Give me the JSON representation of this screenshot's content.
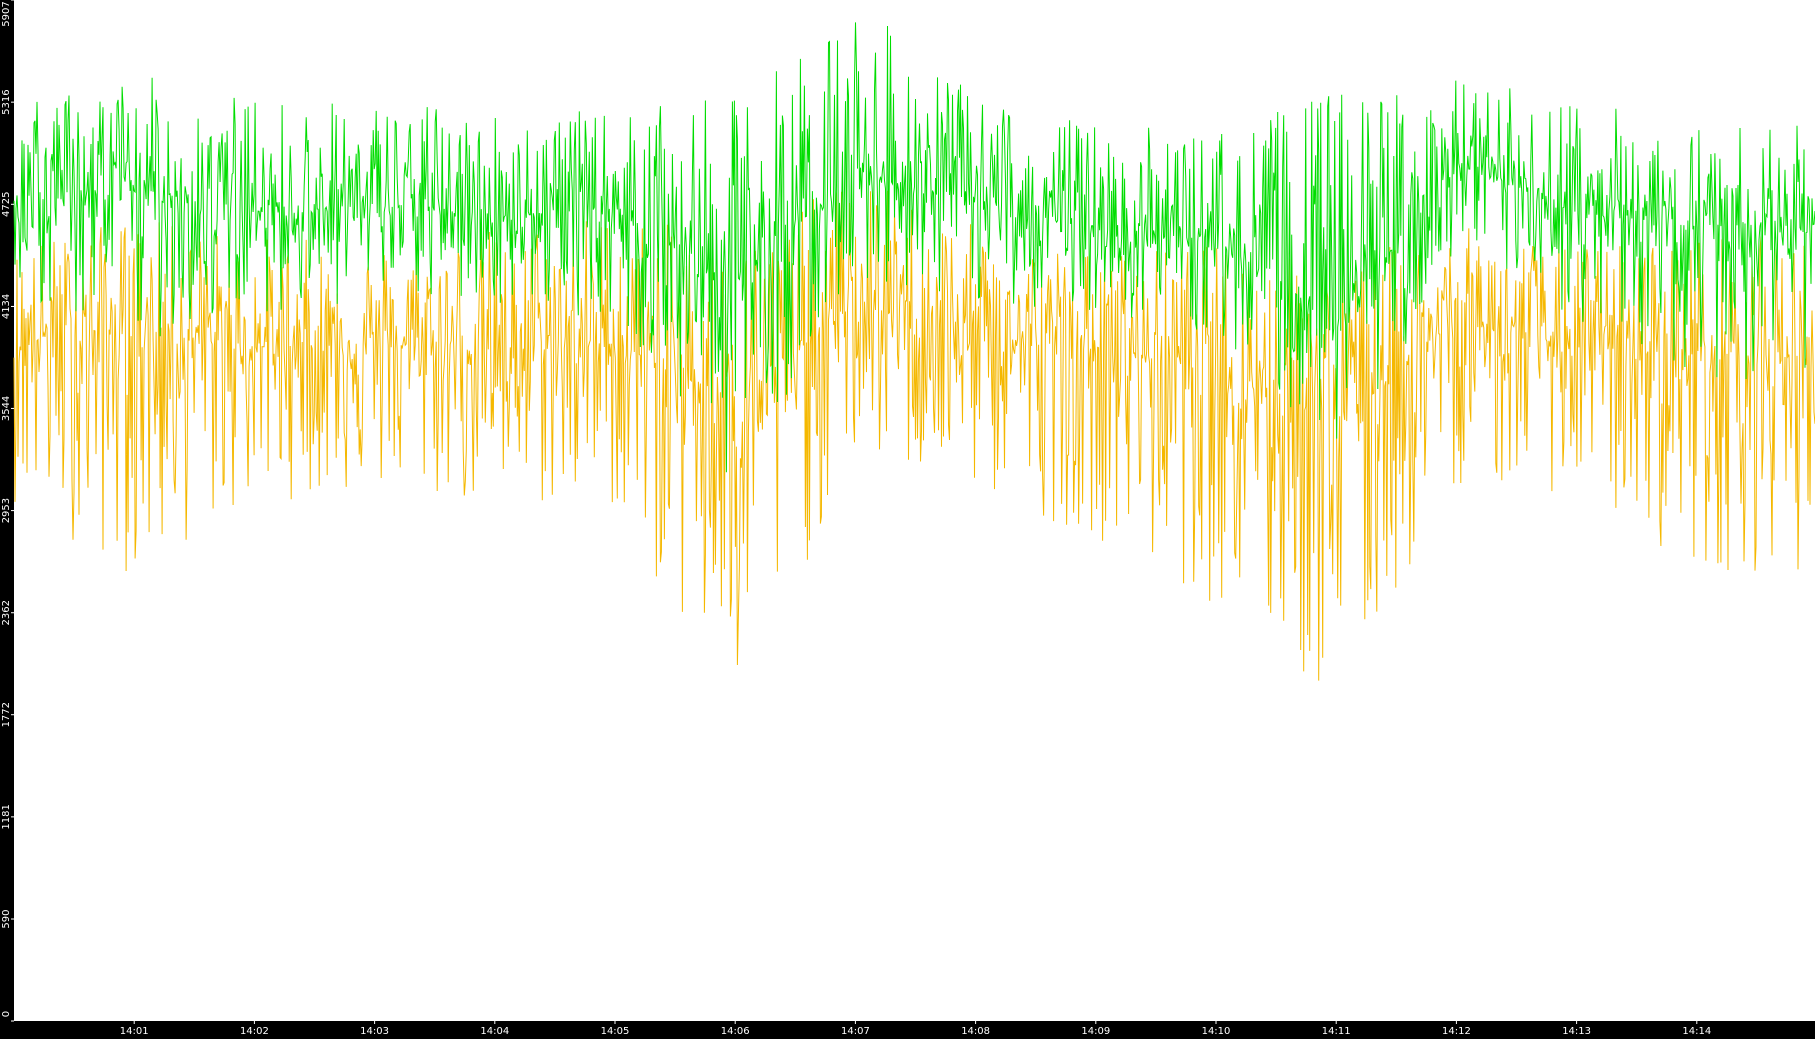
{
  "chart_data": {
    "type": "line",
    "title": "",
    "xlabel": "",
    "ylabel": "",
    "ylim": [
      0,
      5907
    ],
    "yticks": [
      0,
      590,
      1181,
      1772,
      2362,
      2953,
      3544,
      4134,
      4725,
      5316,
      5907
    ],
    "x_tick_labels": [
      "14:01",
      "14:02",
      "14:03",
      "14:04",
      "14:05",
      "14:06",
      "14:07",
      "14:08",
      "14:09",
      "14:10",
      "14:11",
      "14:12",
      "14:13",
      "14:14"
    ],
    "x_range": [
      "14:00:00",
      "14:14:59"
    ],
    "grid": false,
    "legend": "none",
    "series": [
      {
        "color": "#00dd00",
        "x": [
          "14:00",
          "14:01",
          "14:02",
          "14:03",
          "14:04",
          "14:05",
          "14:06",
          "14:07",
          "14:08",
          "14:09",
          "14:10",
          "14:11",
          "14:12",
          "14:13",
          "14:14"
        ],
        "values": [
          4700,
          4820,
          4680,
          4720,
          4660,
          4700,
          4280,
          4920,
          4750,
          4580,
          4520,
          4050,
          4950,
          4680,
          4600
        ],
        "max": [
          5300,
          5480,
          5350,
          5320,
          5280,
          5260,
          5350,
          5907,
          5350,
          5200,
          5150,
          5400,
          5450,
          5350,
          5200
        ],
        "min": [
          4200,
          3900,
          4100,
          4150,
          4150,
          4050,
          3100,
          4300,
          4150,
          4100,
          3950,
          3300,
          4300,
          4050,
          3700
        ]
      },
      {
        "color": "#f5b800",
        "x": [
          "14:00",
          "14:01",
          "14:02",
          "14:03",
          "14:04",
          "14:05",
          "14:06",
          "14:07",
          "14:08",
          "14:09",
          "14:10",
          "14:11",
          "14:12",
          "14:13",
          "14:14"
        ],
        "values": [
          3950,
          3980,
          3900,
          3920,
          3880,
          3920,
          3600,
          4150,
          3950,
          3880,
          3820,
          3500,
          4050,
          3900,
          3850
        ],
        "max": [
          4500,
          4650,
          4550,
          4500,
          4600,
          4700,
          4500,
          4900,
          4600,
          4450,
          4500,
          4400,
          4600,
          4500,
          4550
        ],
        "min": [
          3000,
          2550,
          3000,
          3050,
          2950,
          2950,
          1730,
          3250,
          3050,
          2800,
          2400,
          1760,
          3100,
          3050,
          2600
        ]
      }
    ]
  }
}
